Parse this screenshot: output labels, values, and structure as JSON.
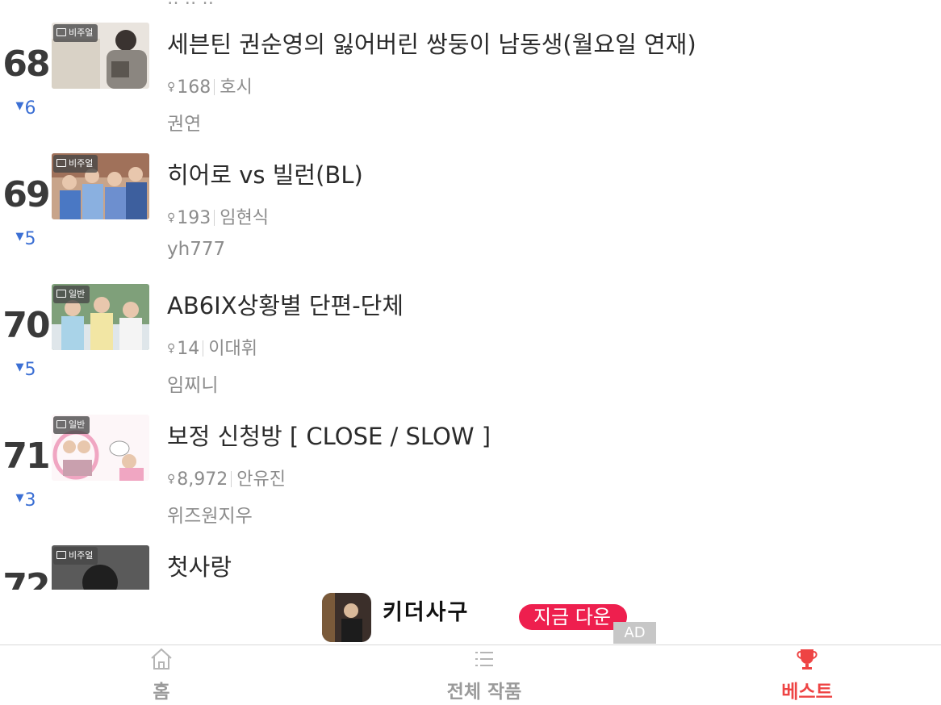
{
  "colors": {
    "accent": "#ee4444",
    "rank_down": "#3b6fd4",
    "ad_cta": "#ee1f4e"
  },
  "list": {
    "items": [
      {
        "rank": "68",
        "change": "6",
        "change_dir": "down",
        "type_icon": "image-icon",
        "type_label": "비주얼",
        "title": "세븐틴 권순영의 잃어버린 쌍둥이 남동생(월요일 연재)",
        "readers": "168",
        "member": "호시",
        "author": "권연"
      },
      {
        "rank": "69",
        "change": "5",
        "change_dir": "down",
        "type_icon": "image-icon",
        "type_label": "비주얼",
        "title": "히어로 vs 빌런(BL)",
        "readers": "193",
        "member": "임현식",
        "author": "yh777"
      },
      {
        "rank": "70",
        "change": "5",
        "change_dir": "down",
        "type_icon": "document-icon",
        "type_label": "일반",
        "title": "AB6IX상황별 단편-단체",
        "readers": "14",
        "member": "이대휘",
        "author": "임찌니"
      },
      {
        "rank": "71",
        "change": "3",
        "change_dir": "down",
        "type_icon": "document-icon",
        "type_label": "일반",
        "title": "보정 신청방 [ CLOSE / SLOW ]",
        "readers": "8,972",
        "member": "안유진",
        "author": "위즈원지우"
      },
      {
        "rank": "72",
        "type_icon": "image-icon",
        "type_label": "비주얼",
        "title": "첫사랑"
      }
    ]
  },
  "ad": {
    "app_name": "키더사구",
    "cta": "지금 다운",
    "label": "AD"
  },
  "tabs": [
    {
      "label": "홈",
      "icon": "home-icon",
      "active": false
    },
    {
      "label": "전체 작품",
      "icon": "list-icon",
      "active": false
    },
    {
      "label": "베스트",
      "icon": "trophy-icon",
      "active": true
    }
  ]
}
